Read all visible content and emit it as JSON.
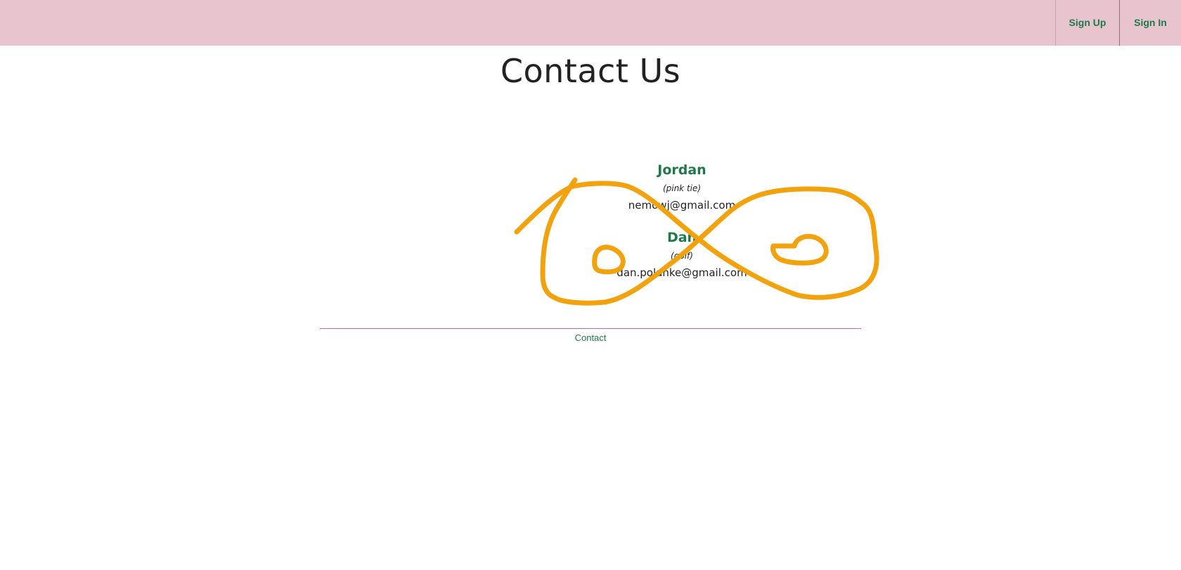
{
  "nav": {
    "sign_up_label": "Sign Up",
    "sign_in_label": "Sign In"
  },
  "page": {
    "title": "Contact Us"
  },
  "contacts": [
    {
      "name": "Jordan",
      "note": "(pink tie)",
      "email": "nemowj@gmail.com"
    },
    {
      "name": "Dan",
      "note": "(golf)",
      "email": "dan.polanke@gmail.com"
    }
  ],
  "footer": {
    "link_label": "Contact"
  },
  "colors": {
    "topbar": "#e8c4cf",
    "accent_green": "#1f7a4a",
    "divider": "#c76b8a",
    "scribble": "#f2a20c"
  },
  "icons": {
    "scribble": "orange-freehand-scribble"
  }
}
